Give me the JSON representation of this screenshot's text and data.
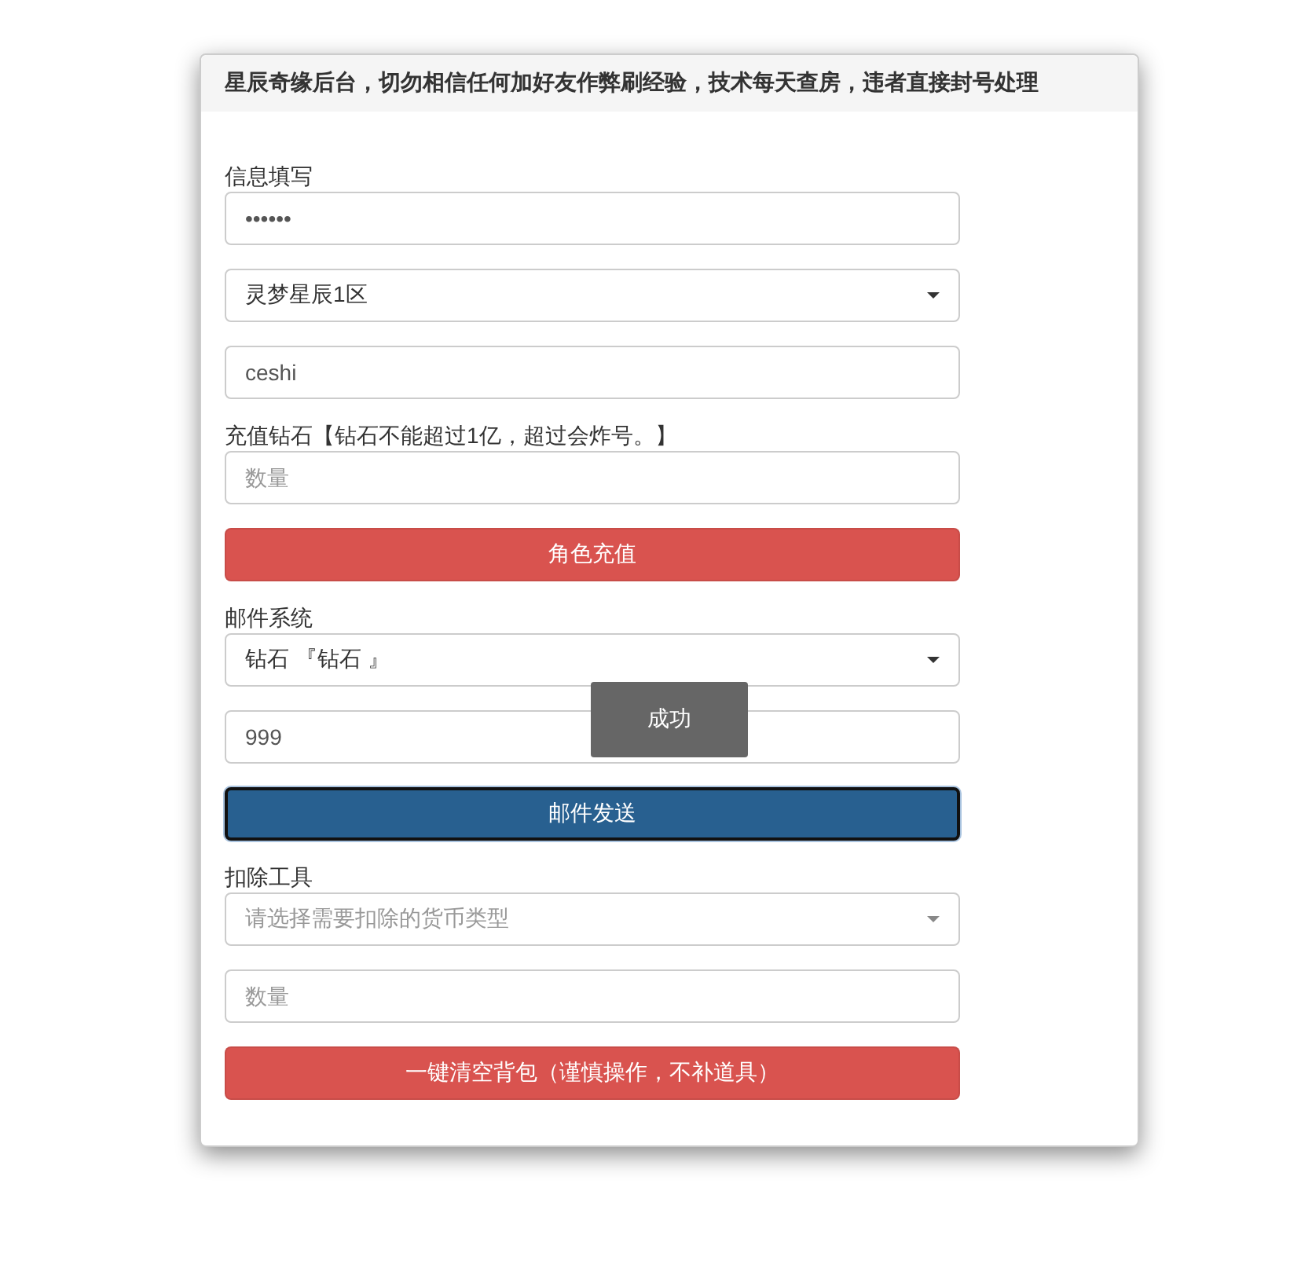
{
  "panel": {
    "heading": "星辰奇缘后台，切勿相信任何加好友作弊刷经验，技术每天查房，违者直接封号处理",
    "items": [
      {
        "kind": "label",
        "text": "信息填写"
      },
      {
        "kind": "input",
        "value": "••••••"
      },
      {
        "kind": "select",
        "value": "灵梦星辰1区"
      },
      {
        "kind": "input",
        "value": "ceshi"
      },
      {
        "kind": "label",
        "text": "充值钻石【钻石不能超过1亿，超过会炸号。】"
      },
      {
        "kind": "input",
        "placeholder": "数量"
      },
      {
        "kind": "button",
        "text": "角色充值",
        "color": "#d9534f",
        "focused": false
      },
      {
        "kind": "label",
        "text": "邮件系统"
      },
      {
        "kind": "select",
        "value": "钻石 『钻石 』"
      },
      {
        "kind": "input",
        "value": "999"
      },
      {
        "kind": "button",
        "text": "邮件发送",
        "color": "#286090",
        "focused": true
      },
      {
        "kind": "label",
        "text": "扣除工具"
      },
      {
        "kind": "select",
        "placeholder": "请选择需要扣除的货币类型"
      },
      {
        "kind": "input",
        "placeholder": "数量"
      },
      {
        "kind": "button",
        "text": "一键清空背包（谨慎操作，不补道具）",
        "color": "#d9534f",
        "focused": false
      }
    ]
  },
  "toast": {
    "text": "成功"
  }
}
